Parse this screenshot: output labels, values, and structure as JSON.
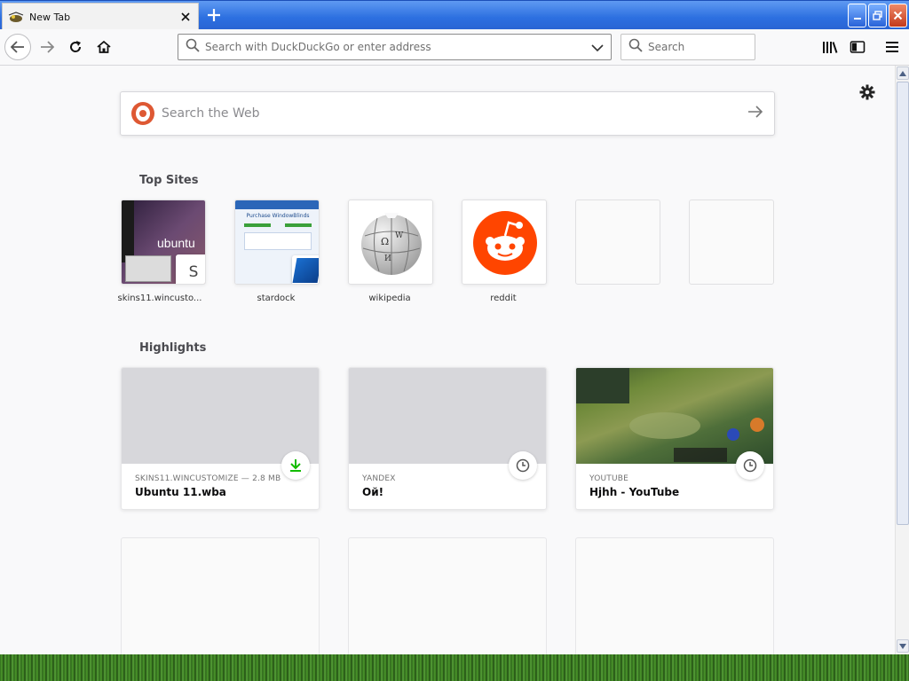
{
  "window": {
    "tab_title": "New Tab",
    "newtab_symbol": "+"
  },
  "toolbar": {
    "url_placeholder": "Search with DuckDuckGo or enter address",
    "search_placeholder": "Search"
  },
  "content": {
    "websearch_placeholder": "Search the Web",
    "top_sites_title": "Top Sites",
    "highlights_title": "Highlights",
    "top_sites": [
      {
        "label": "skins11.wincusto...",
        "badge": "S"
      },
      {
        "label": "stardock",
        "thumb_text": "Purchase WindowBlinds"
      },
      {
        "label": "wikipedia"
      },
      {
        "label": "reddit"
      }
    ],
    "highlights": [
      {
        "source": "SKINS11.WINCUSTOMIZE — 2.8 MB",
        "title": "Ubuntu 11.wba",
        "badge_icon": "download-icon"
      },
      {
        "source": "YANDEX",
        "title": "Ой!",
        "badge_icon": "clock-icon"
      },
      {
        "source": "YOUTUBE",
        "title": "Hjhh - YouTube",
        "badge_icon": "clock-icon"
      }
    ],
    "ubuntu_thumb_text": "ubuntu"
  },
  "colors": {
    "ddg_brand": "#de5833",
    "reddit_brand": "#ff4500",
    "download_green": "#12bc00"
  }
}
